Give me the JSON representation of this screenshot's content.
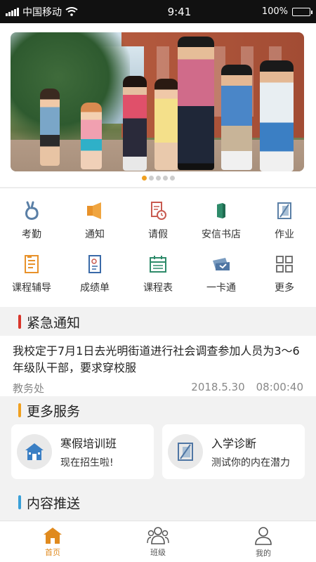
{
  "status_bar": {
    "carrier": "中国移动",
    "time": "9:41",
    "battery": "100%",
    "battery_level": 1.0
  },
  "banner": {
    "slide_count": 5,
    "active_index": 0
  },
  "quick_menu": {
    "items": [
      {
        "label": "考勤",
        "icon": "attendance-icon"
      },
      {
        "label": "通知",
        "icon": "megaphone-icon"
      },
      {
        "label": "请假",
        "icon": "leave-request-icon"
      },
      {
        "label": "安信书店",
        "icon": "bookstore-icon"
      },
      {
        "label": "作业",
        "icon": "homework-icon"
      },
      {
        "label": "课程辅导",
        "icon": "course-tutoring-icon"
      },
      {
        "label": "成绩单",
        "icon": "report-card-icon"
      },
      {
        "label": "课程表",
        "icon": "timetable-icon"
      },
      {
        "label": "一卡通",
        "icon": "campus-card-icon"
      },
      {
        "label": "更多",
        "icon": "more-grid-icon"
      }
    ]
  },
  "urgent_notice": {
    "heading": "紧急通知",
    "text": "我校定于7月1日去光明街道进行社会调查参加人员为3～6年级队干部，要求穿校服",
    "source": "教务处",
    "date": "2018.5.30",
    "time": "08:00:40"
  },
  "more_services": {
    "heading": "更多服务",
    "cards": [
      {
        "title": "寒假培训班",
        "subtitle": "现在招生啦!",
        "icon": "school-house-icon"
      },
      {
        "title": "入学诊断",
        "subtitle": "测试你的内在潜力",
        "icon": "diagnosis-icon"
      }
    ]
  },
  "content_push": {
    "heading": "内容推送"
  },
  "tab_bar": {
    "tabs": [
      {
        "label": "首页",
        "icon": "home-icon",
        "active": true
      },
      {
        "label": "班级",
        "icon": "class-icon",
        "active": false
      },
      {
        "label": "我的",
        "icon": "profile-icon",
        "active": false
      }
    ]
  },
  "colors": {
    "accent": "#e08a1e",
    "urgent_bar": "#d9362b",
    "services_bar": "#f0a020",
    "push_bar": "#3aa0d8"
  }
}
